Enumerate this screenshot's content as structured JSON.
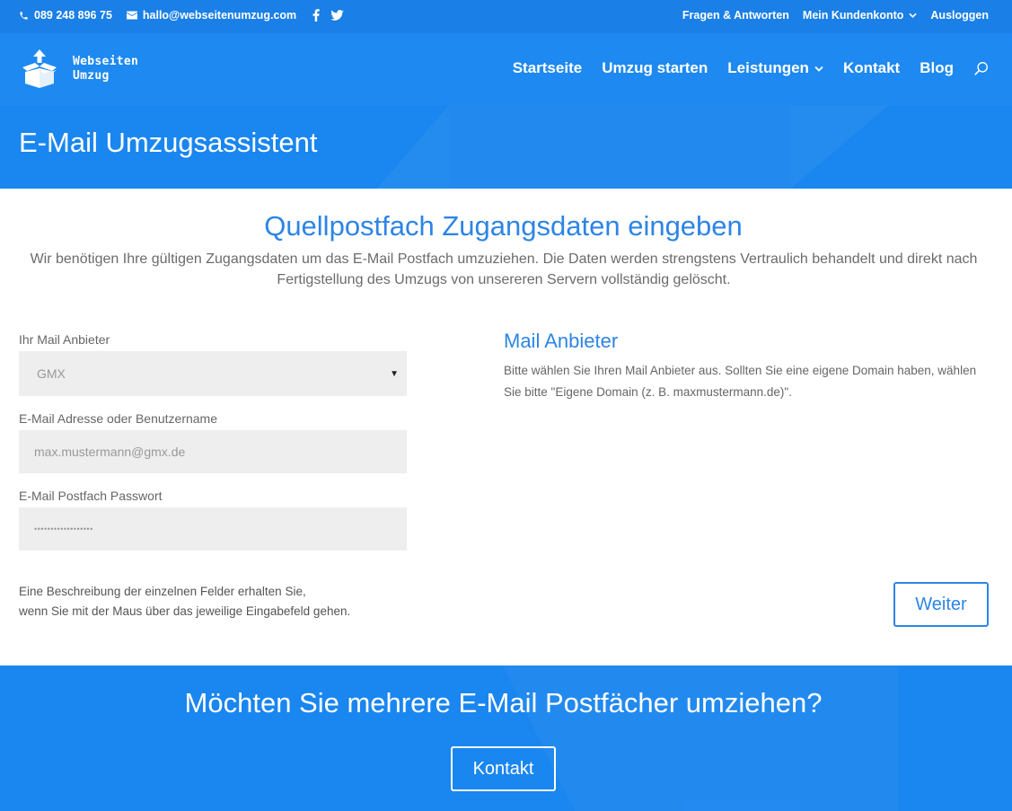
{
  "topbar": {
    "phone": "089 248 896 75",
    "email": "hallo@webseitenumzug.com",
    "social": [
      "facebook-icon",
      "twitter-icon"
    ],
    "links": {
      "faq": "Fragen & Antworten",
      "account": "Mein Kundenkonto",
      "logout": "Ausloggen"
    }
  },
  "header": {
    "logo_line1": "Webseiten",
    "logo_line2": "Umzug",
    "nav": {
      "home": "Startseite",
      "start": "Umzug starten",
      "services": "Leistungen",
      "contact": "Kontakt",
      "blog": "Blog"
    }
  },
  "hero": {
    "title": "E-Mail Umzugsassistent"
  },
  "main": {
    "title": "Quellpostfach Zugangsdaten eingeben",
    "intro": "Wir benötigen Ihre gültigen Zugangsdaten um das E-Mail Postfach umzuziehen. Die Daten werden strengstens Vertraulich behandelt und direkt nach Fertigstellung des Umzugs von unsereren Servern vollständig gelöscht.",
    "provider_label": "Ihr Mail Anbieter",
    "provider_value": "GMX",
    "email_label": "E-Mail Adresse oder Benutzername",
    "email_placeholder": "max.mustermann@gmx.de",
    "password_label": "E-Mail Postfach Passwort",
    "password_value": "••••••••••••••••••",
    "side_title": "Mail Anbieter",
    "side_text": "Bitte wählen Sie Ihren Mail Anbieter aus. Sollten Sie eine eigene Domain haben, wählen Sie bitte \"Eigene Domain (z. B. maxmustermann.de)\".",
    "hint_line1": "Eine Beschreibung der einzelnen Felder erhalten Sie,",
    "hint_line2": "wenn Sie mit der Maus über das jeweilige Eingabefeld gehen.",
    "next_button": "Weiter"
  },
  "cta": {
    "title": "Möchten Sie mehrere E-Mail Postfächer umziehen?",
    "button": "Kontakt"
  },
  "colors": {
    "primary": "#1e89f0",
    "accent": "#2d85e4"
  }
}
